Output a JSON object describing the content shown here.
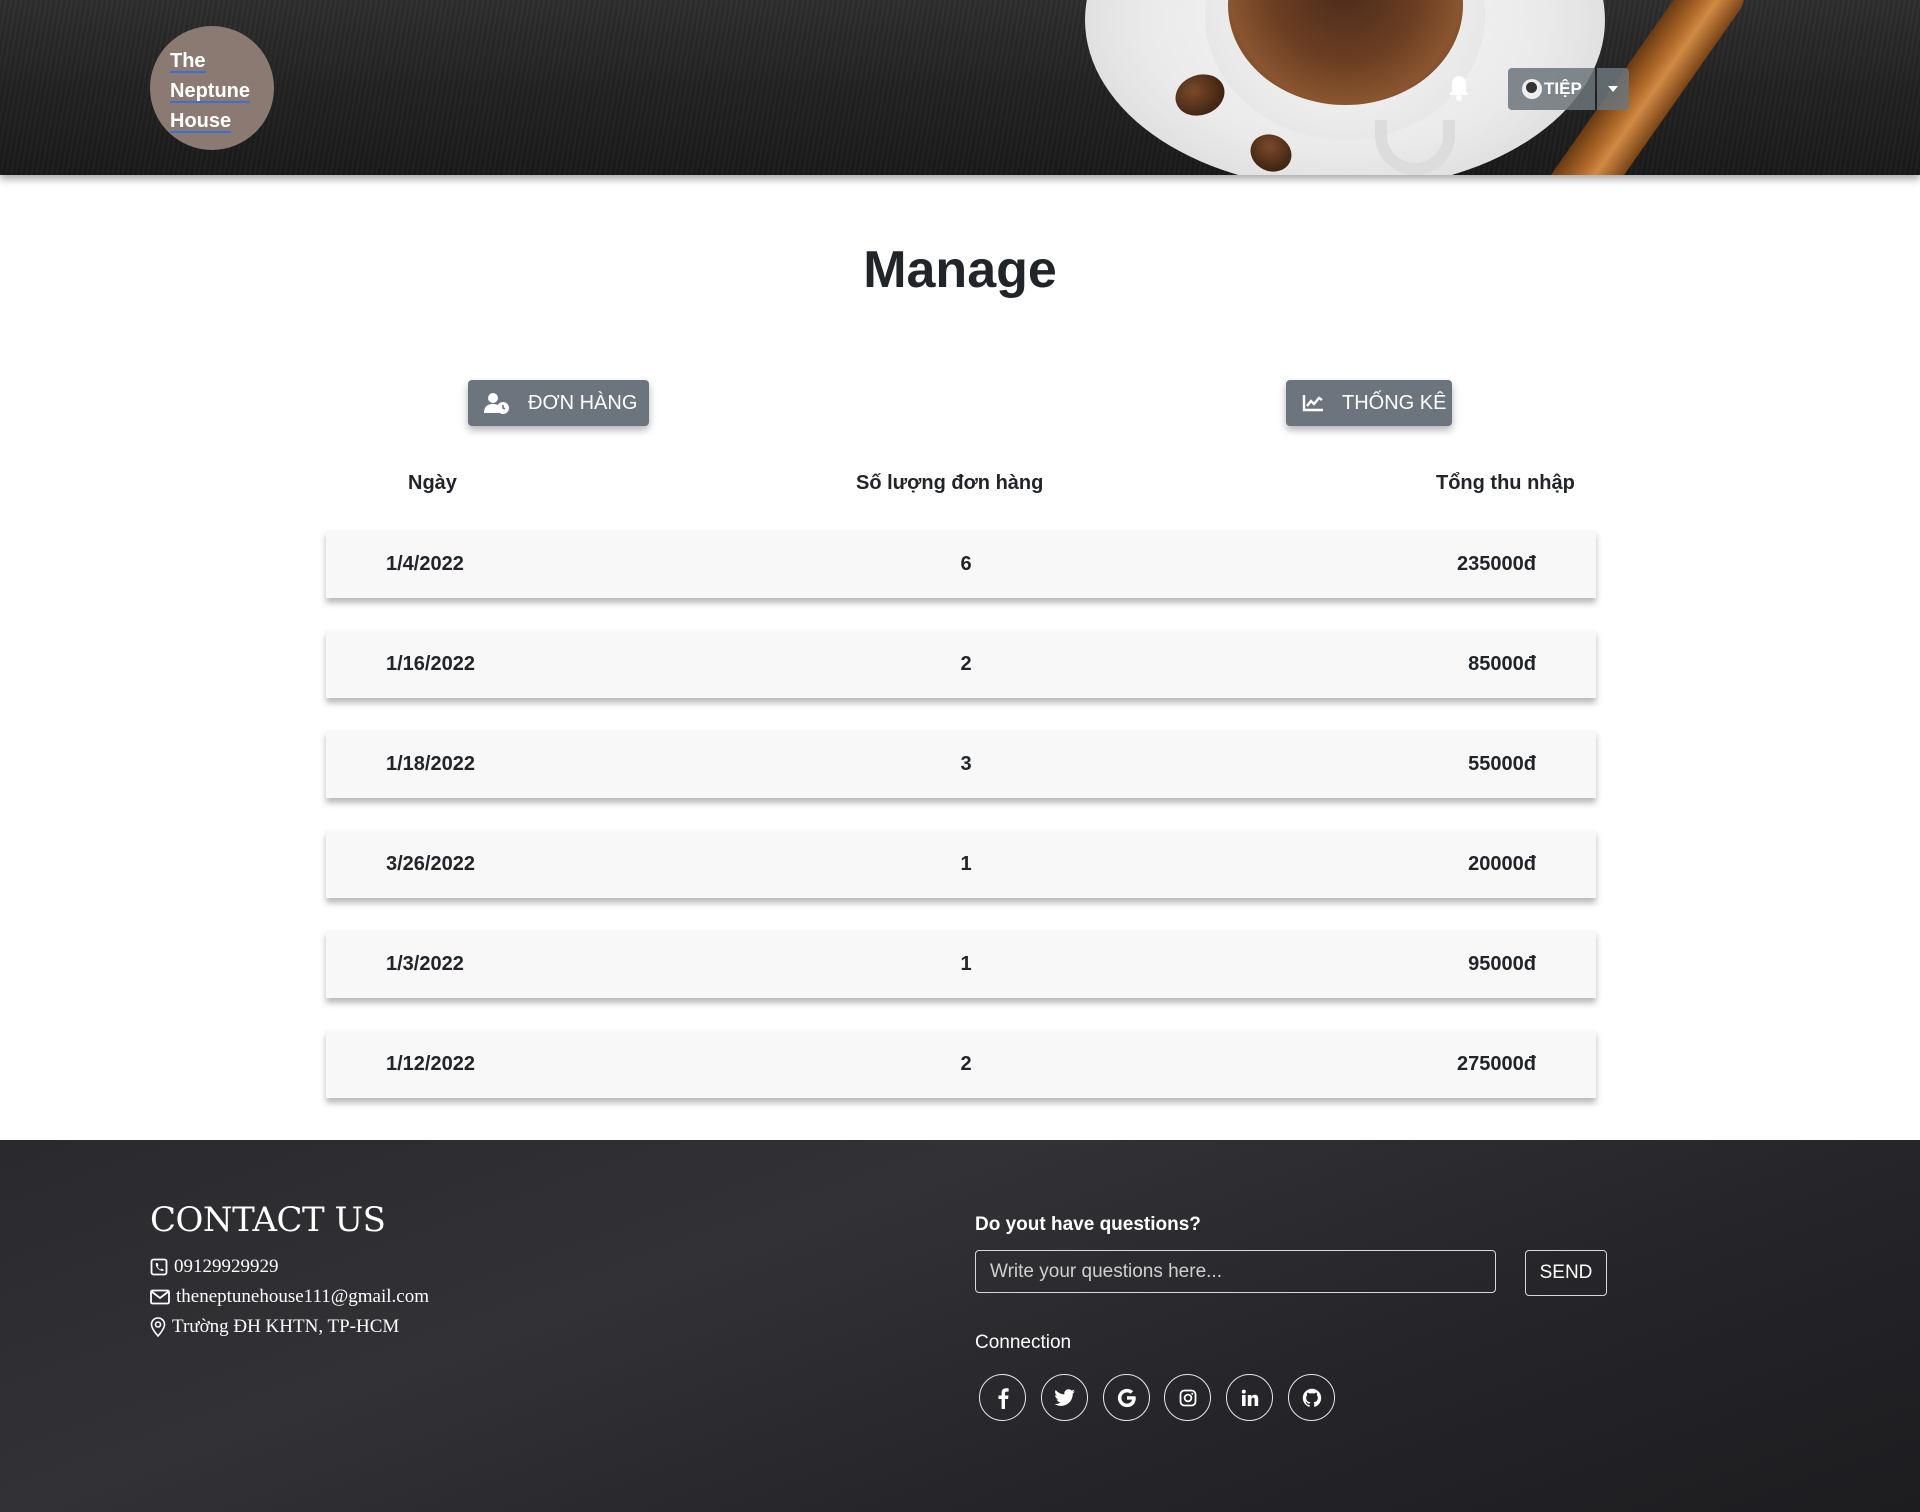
{
  "brand": {
    "logo_lines": [
      "The",
      "Neptune",
      "House"
    ]
  },
  "header": {
    "user_name": "TIỆP"
  },
  "main": {
    "title": "Manage",
    "tabs": [
      {
        "label": "ĐƠN HÀNG",
        "icon": "user-clock-icon"
      },
      {
        "label": "THỐNG KÊ",
        "icon": "chart-line-icon"
      }
    ],
    "columns": [
      "Ngày",
      "Số lượng đơn hàng",
      "Tổng thu nhập"
    ],
    "rows": [
      {
        "date": "1/4/2022",
        "count": "6",
        "total": "235000đ"
      },
      {
        "date": "1/16/2022",
        "count": "2",
        "total": "85000đ"
      },
      {
        "date": "1/18/2022",
        "count": "3",
        "total": "55000đ"
      },
      {
        "date": "3/26/2022",
        "count": "1",
        "total": "20000đ"
      },
      {
        "date": "1/3/2022",
        "count": "1",
        "total": "95000đ"
      },
      {
        "date": "1/12/2022",
        "count": "2",
        "total": "275000đ"
      }
    ]
  },
  "footer": {
    "contact_title": "CONTACT US",
    "phone": "09129929929",
    "email": "theneptunehouse111@gmail.com",
    "address": "Trường ĐH KHTN, TP-HCM",
    "question_label": "Do yout have questions?",
    "question_placeholder": "Write your questions here...",
    "send_label": "SEND",
    "connection_label": "Connection",
    "social_icons": [
      "facebook-icon",
      "twitter-icon",
      "google-icon",
      "instagram-icon",
      "linkedin-icon",
      "github-icon"
    ]
  },
  "colors": {
    "button_gray": "#6c757d",
    "footer_bg": "#2a2a2e",
    "logo_bg": "#8a7a72",
    "row_bg": "#f8f8f8"
  }
}
